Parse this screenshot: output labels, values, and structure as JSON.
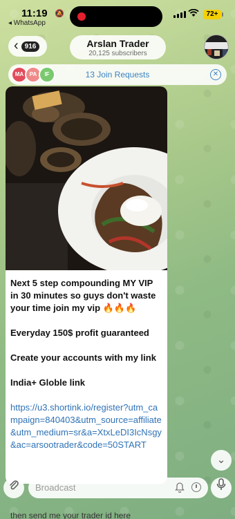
{
  "status_bar": {
    "time": "11:19",
    "back_app": "◂ WhatsApp",
    "battery": "72+"
  },
  "header": {
    "back_count": "916",
    "channel_name": "Arslan Trader",
    "subscribers": "20,125 subscribers"
  },
  "join_requests": {
    "avatars": [
      "MA",
      "PA",
      "IF"
    ],
    "label": "13 Join Requests"
  },
  "message": {
    "line1": "Next 5 step compounding MY VIP in 30 minutes so guys don't waste your time join my vip 🔥🔥🔥",
    "line2": "Everyday 150$ profit guaranteed",
    "line3": "Create your accounts with my link",
    "line4": "India+ Globle link",
    "link": "https://u3.shortink.io/register?utm_campaign=840403&utm_source=affiliate&utm_medium=sr&a=XtxLeDI3IcNsgy&ac=arsootrader&code=50START"
  },
  "composer": {
    "placeholder": "Broadcast"
  },
  "behind_text": "then send me your trader id here",
  "colors": {
    "accent": "#3b82c4",
    "link": "#2f72b5",
    "record": "#e4202e",
    "battery": "#f5d000"
  },
  "icons": [
    "chevron-left-icon",
    "close-icon",
    "chevron-down-icon",
    "paperclip-icon",
    "bell-icon",
    "timer-icon",
    "mic-icon"
  ]
}
